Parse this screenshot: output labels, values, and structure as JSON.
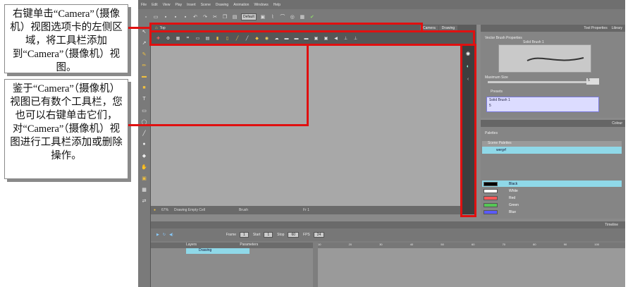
{
  "callouts": {
    "first": "右键单击“Camera”（摄像机）视图选项卡的左侧区域，将工具栏添加到“Camera”（摄像机）视图。",
    "second": "鉴于“Camera”（摄像机）视图已有数个工具栏，您也可以右键单击它们，对“Camera”（摄像机）视图进行工具栏添加或删除操作。"
  },
  "menu": [
    "File",
    "Edit",
    "View",
    "Play",
    "Insert",
    "Scene",
    "Drawing",
    "Animation",
    "Windows",
    "Help"
  ],
  "toolbar": {
    "dropdown": "Default"
  },
  "view": {
    "title": "Top",
    "tabs": [
      "Camera",
      "Drawing"
    ]
  },
  "status": {
    "zoom": "67%",
    "message": "Drawing Empty Cell",
    "tool": "Brush",
    "frame": "Fr 1"
  },
  "tool_properties": {
    "tabs": [
      "Tool Properties",
      "Library"
    ],
    "section": "Vector Brush Properties",
    "brush_name": "Solid Brush 1",
    "max_size_label": "Maximum Size",
    "max_size_value": "5",
    "presets_label": "Presets",
    "presets": [
      "Solid Brush 1",
      "5"
    ]
  },
  "colour": {
    "tab": "Colour",
    "palettes_label": "Palettes",
    "scene_palettes": "Scene Palettes",
    "palette_name": "wergrf",
    "swatches": [
      {
        "name": "Black",
        "color": "#000000"
      },
      {
        "name": "White",
        "color": "#ffffff"
      },
      {
        "name": "Red",
        "color": "#ff5a5a"
      },
      {
        "name": "Green",
        "color": "#55c855"
      },
      {
        "name": "Blue",
        "color": "#5a5aff"
      }
    ]
  },
  "timeline": {
    "tab": "Timeline",
    "frame_label": "Frame",
    "frame_value": "1",
    "start_label": "Start",
    "start_value": "1",
    "stop_label": "Stop",
    "stop_value": "60",
    "fps_label": "FPS",
    "fps_value": "24",
    "layers_header": "Layers",
    "params_header": "Parameters",
    "layer_name": "Drawing",
    "ruler": [
      "10",
      "20",
      "30",
      "40",
      "50",
      "60",
      "70",
      "80",
      "90",
      "100"
    ]
  }
}
